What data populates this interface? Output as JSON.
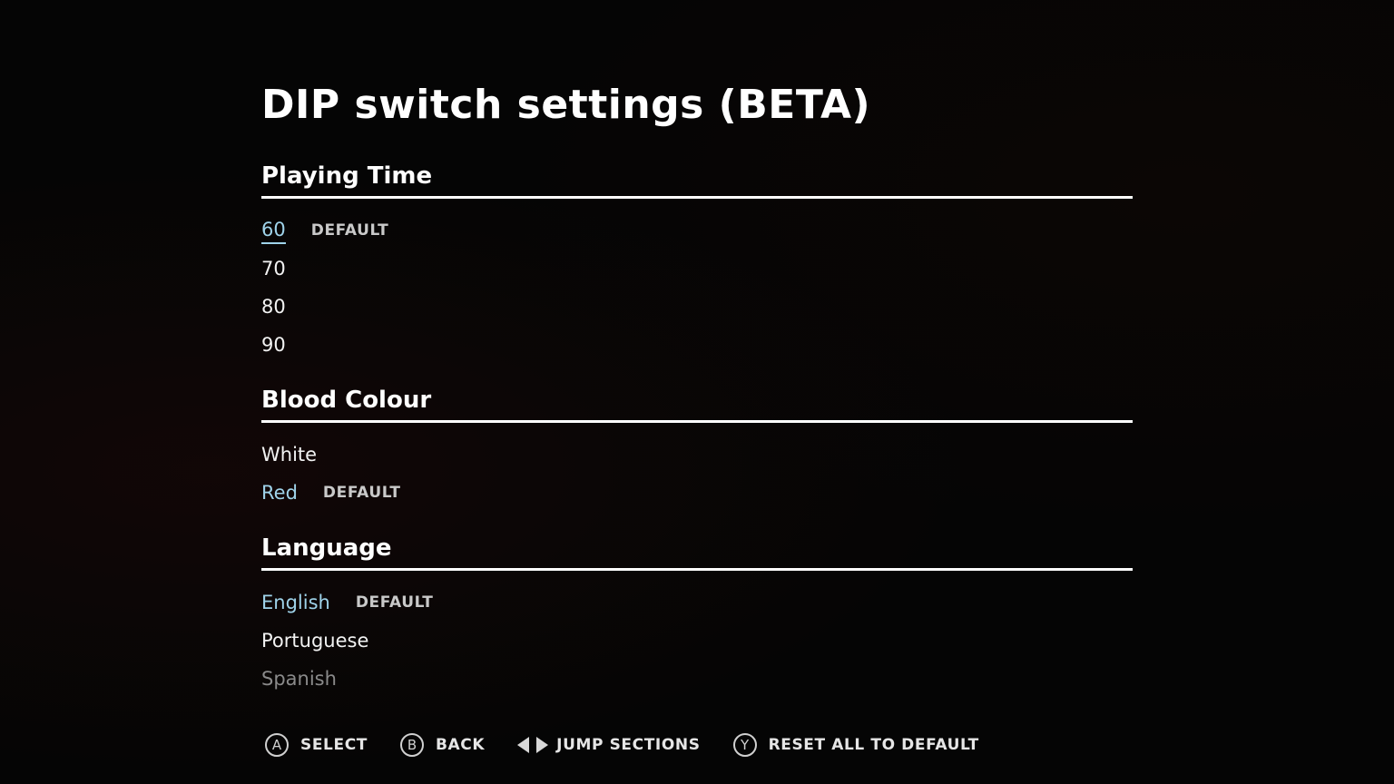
{
  "title": "DIP switch settings (BETA)",
  "default_tag": "DEFAULT",
  "sections": [
    {
      "name": "Playing Time",
      "options": [
        "60",
        "70",
        "80",
        "90"
      ],
      "selected_index": 0,
      "default_index": 0
    },
    {
      "name": "Blood Colour",
      "options": [
        "White",
        "Red"
      ],
      "selected_index": 1,
      "default_index": 1
    },
    {
      "name": "Language",
      "options": [
        "English",
        "Portuguese",
        "Spanish"
      ],
      "selected_index": 0,
      "default_index": 0
    }
  ],
  "footer": {
    "select": {
      "button": "A",
      "label": "SELECT"
    },
    "back": {
      "button": "B",
      "label": "BACK"
    },
    "jump": {
      "icon": "left-right-arrows-icon",
      "label": "JUMP SECTIONS"
    },
    "reset": {
      "button": "Y",
      "label": "RESET ALL TO DEFAULT"
    }
  },
  "colors": {
    "accent": "#9fd3ea",
    "background": "#050505",
    "text": "#f2f2f2"
  }
}
